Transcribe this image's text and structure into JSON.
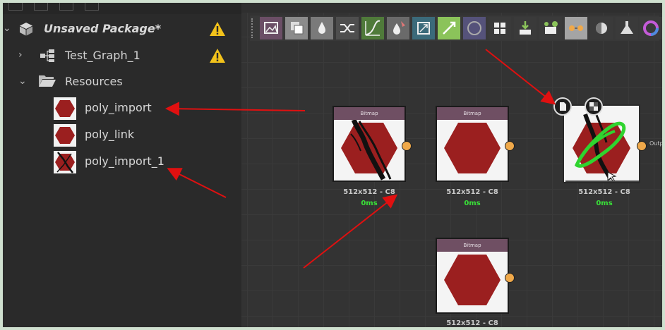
{
  "explorer": {
    "package_label": "Unsaved Package*",
    "graph_label": "Test_Graph_1",
    "folder_label": "Resources",
    "resources": [
      {
        "label": "poly_import"
      },
      {
        "label": "poly_link"
      },
      {
        "label": "poly_import_1"
      }
    ]
  },
  "toolbar": {
    "icons": [
      "image-input-icon",
      "blend-icon",
      "levels-icon",
      "shuffle-icon",
      "curve-icon",
      "color-drop-icon",
      "transform-icon",
      "gradient-icon",
      "circle-icon",
      "grid-icon",
      "download-icon",
      "tree-icon",
      "connector-icon",
      "half-circle-icon",
      "flask-icon",
      "color-wheel-icon"
    ]
  },
  "graph": {
    "nodes": [
      {
        "header": "Bitmap",
        "resolution": "512x512 - C8",
        "time": "0ms"
      },
      {
        "header": "Bitmap",
        "resolution": "512x512 - C8",
        "time": "0ms"
      },
      {
        "header": "",
        "resolution": "512x512 - C8",
        "time": "0ms",
        "output_label": "Outp"
      },
      {
        "header": "Bitmap",
        "resolution": "512x512 - C8",
        "time": ""
      }
    ]
  },
  "colors": {
    "hexagon": "#9b1f1f",
    "annotation_arrow": "#e01010",
    "green_scribble": "#2fd42f",
    "port": "#f0a94a",
    "node_header": "#6f4f63",
    "time_text": "#39e038"
  }
}
